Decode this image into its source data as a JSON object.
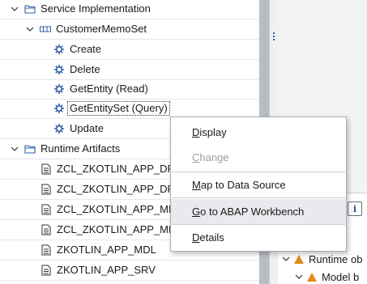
{
  "tree": {
    "rows": [
      {
        "label": "Service Implementation",
        "expander": "collapse",
        "icon": "folder-icon"
      },
      {
        "label": "CustomerMemoSet",
        "expander": "collapse",
        "icon": "entity-set-icon"
      },
      {
        "label": "Create",
        "icon": "operation-gear-icon"
      },
      {
        "label": "Delete",
        "icon": "operation-gear-icon"
      },
      {
        "label": "GetEntity (Read)",
        "icon": "operation-gear-icon"
      },
      {
        "label": "GetEntitySet (Query)",
        "icon": "operation-gear-icon",
        "selected": true
      },
      {
        "label": "Update",
        "icon": "operation-gear-icon"
      },
      {
        "label": "Runtime Artifacts",
        "expander": "collapse",
        "icon": "folder-icon"
      },
      {
        "label": "ZCL_ZKOTLIN_APP_DPC",
        "icon": "document-icon"
      },
      {
        "label": "ZCL_ZKOTLIN_APP_DPC_EXT",
        "icon": "document-icon"
      },
      {
        "label": "ZCL_ZKOTLIN_APP_MPC",
        "icon": "document-icon"
      },
      {
        "label": "ZCL_ZKOTLIN_APP_MPC_EXT",
        "icon": "document-icon"
      },
      {
        "label": "ZKOTLIN_APP_MDL",
        "icon": "document-icon"
      },
      {
        "label": "ZKOTLIN_APP_SRV",
        "icon": "document-icon"
      }
    ]
  },
  "context_menu": {
    "items": [
      {
        "label": "Display",
        "mnemonic": "D",
        "rest": "isplay",
        "enabled": true
      },
      {
        "label": "Change",
        "mnemonic": "C",
        "rest": "hange",
        "enabled": false
      },
      {
        "label": "Map to Data Source",
        "mnemonic": "M",
        "rest": "ap to Data Source",
        "enabled": true
      },
      {
        "label": "Go to ABAP Workbench",
        "mnemonic": "G",
        "rest": "o to ABAP Workbench",
        "enabled": true,
        "hover": true
      },
      {
        "label": "Details",
        "mnemonic": "D",
        "rest": "etails",
        "enabled": true
      }
    ]
  },
  "right_panel": {
    "rows": [
      {
        "label": "Runtime ob",
        "icon": "warning-icon"
      },
      {
        "label": "Model b",
        "icon": "warning-icon"
      }
    ],
    "info_button": "i"
  },
  "colors": {
    "warning": "#e0891b",
    "gear": "#2f5fa8",
    "row_border": "#e4e8ec",
    "hover": "#e8eaed"
  }
}
